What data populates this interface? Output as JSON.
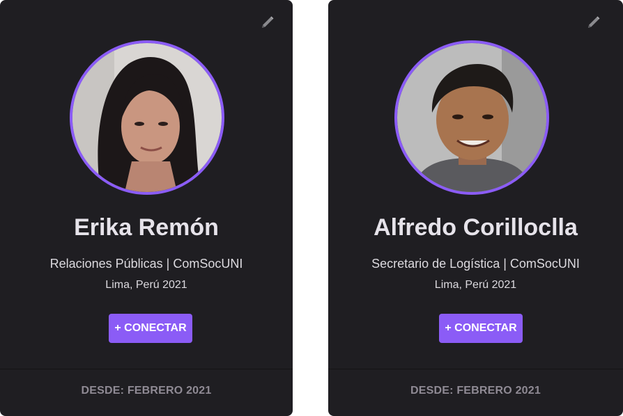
{
  "cards": [
    {
      "name": "Erika Remón",
      "role": "Relaciones Públicas | ComSocUNI",
      "location": "Lima, Perú 2021",
      "button_label": "+ CONECTAR",
      "footer": "DESDE: FEBRERO 2021",
      "edit_icon": "pencil-icon"
    },
    {
      "name": "Alfredo Corilloclla",
      "role": "Secretario de Logística | ComSocUNI",
      "location": "Lima, Perú 2021",
      "button_label": "+ CONECTAR",
      "footer": "DESDE: FEBRERO 2021",
      "edit_icon": "pencil-icon"
    }
  ],
  "colors": {
    "card_bg": "#1f1e22",
    "accent": "#8b5cf6",
    "footer_text": "#8f8a94"
  }
}
